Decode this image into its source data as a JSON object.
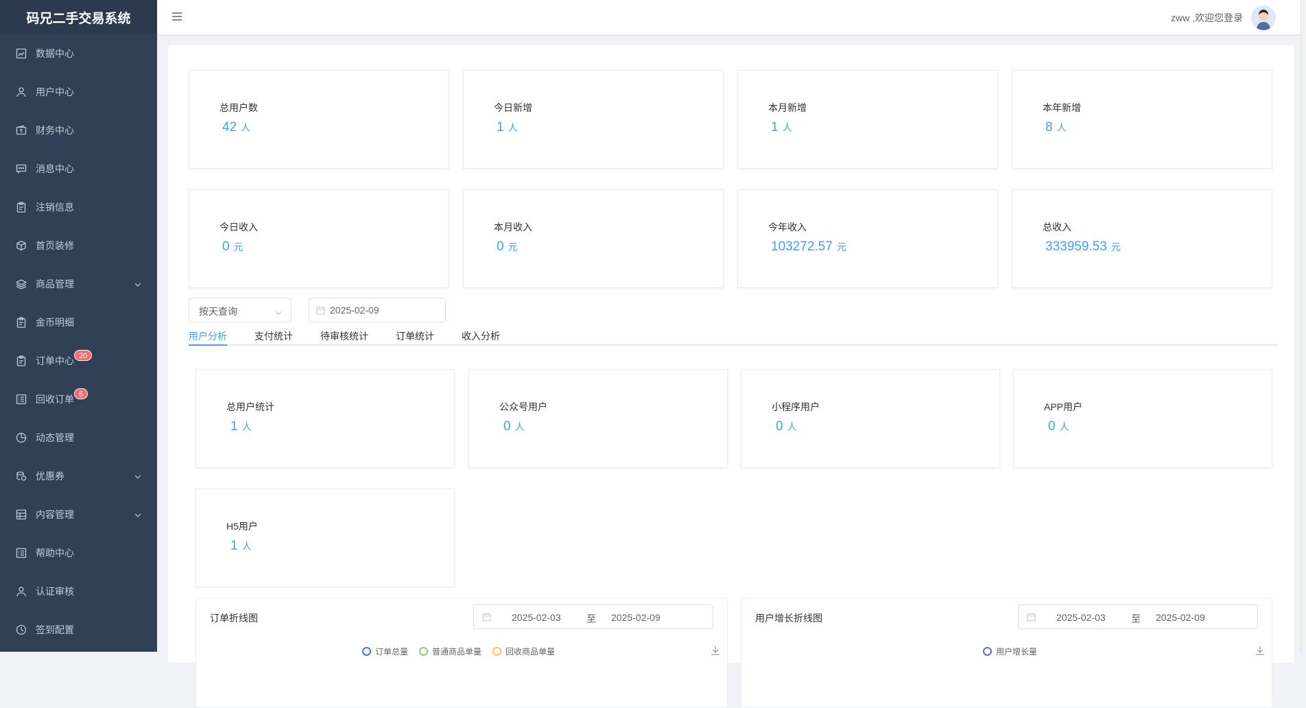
{
  "brand": "码兄二手交易系统",
  "sidebar": {
    "items": [
      {
        "label": "数据中心",
        "icon": "chart-icon"
      },
      {
        "label": "用户中心",
        "icon": "user-icon"
      },
      {
        "label": "财务中心",
        "icon": "wallet-icon"
      },
      {
        "label": "消息中心",
        "icon": "message-icon"
      },
      {
        "label": "注销信息",
        "icon": "clipboard-icon"
      },
      {
        "label": "首页装修",
        "icon": "box-icon"
      },
      {
        "label": "商品管理",
        "icon": "layers-icon"
      },
      {
        "label": "金币明细",
        "icon": "clipboard-icon"
      },
      {
        "label": "订单中心",
        "icon": "clipboard-icon",
        "badge": "20"
      },
      {
        "label": "回收订单",
        "icon": "list-icon",
        "badge": "6"
      },
      {
        "label": "动态管理",
        "icon": "pie-icon"
      },
      {
        "label": "优惠券",
        "icon": "coins-icon"
      },
      {
        "label": "内容管理",
        "icon": "grid-icon"
      },
      {
        "label": "帮助中心",
        "icon": "list-icon"
      },
      {
        "label": "认证审核",
        "icon": "user-icon"
      },
      {
        "label": "签到配置",
        "icon": "clock-icon"
      }
    ]
  },
  "header": {
    "welcome": "zww ,欢迎您登录"
  },
  "stats_row1": [
    {
      "label": "总用户数",
      "value": "42",
      "unit": "人"
    },
    {
      "label": "今日新增",
      "value": "1",
      "unit": "人"
    },
    {
      "label": "本月新增",
      "value": "1",
      "unit": "人"
    },
    {
      "label": "本年新增",
      "value": "8",
      "unit": "人"
    }
  ],
  "stats_row2": [
    {
      "label": "今日收入",
      "value": "0",
      "unit": "元"
    },
    {
      "label": "本月收入",
      "value": "0",
      "unit": "元"
    },
    {
      "label": "今年收入",
      "value": "103272.57",
      "unit": "元"
    },
    {
      "label": "总收入",
      "value": "333959.53",
      "unit": "元"
    }
  ],
  "filter": {
    "mode": "按天查询",
    "date": "2025-02-09"
  },
  "tabs": [
    "用户分析",
    "支付统计",
    "待审核统计",
    "订单统计",
    "收入分析"
  ],
  "user_stats": [
    {
      "label": "总用户统计",
      "value": "1",
      "unit": "人"
    },
    {
      "label": "公众号用户",
      "value": "0",
      "unit": "人"
    },
    {
      "label": "小程序用户",
      "value": "0",
      "unit": "人"
    },
    {
      "label": "APP用户",
      "value": "0",
      "unit": "人"
    },
    {
      "label": "H5用户",
      "value": "1",
      "unit": "人"
    }
  ],
  "panels": {
    "order": {
      "title": "订单折线图",
      "start": "2025-02-03",
      "sep": "至",
      "end": "2025-02-09",
      "legend": [
        "订单总量",
        "普通商品单量",
        "回收商品单量"
      ]
    },
    "growth": {
      "title": "用户增长折线图",
      "start": "2025-02-03",
      "sep": "至",
      "end": "2025-02-09",
      "legend": [
        "用户增长量"
      ]
    }
  },
  "colors": {
    "accent": "#409eff",
    "legend": [
      "#5470c6",
      "#91cc75",
      "#fac858"
    ]
  }
}
